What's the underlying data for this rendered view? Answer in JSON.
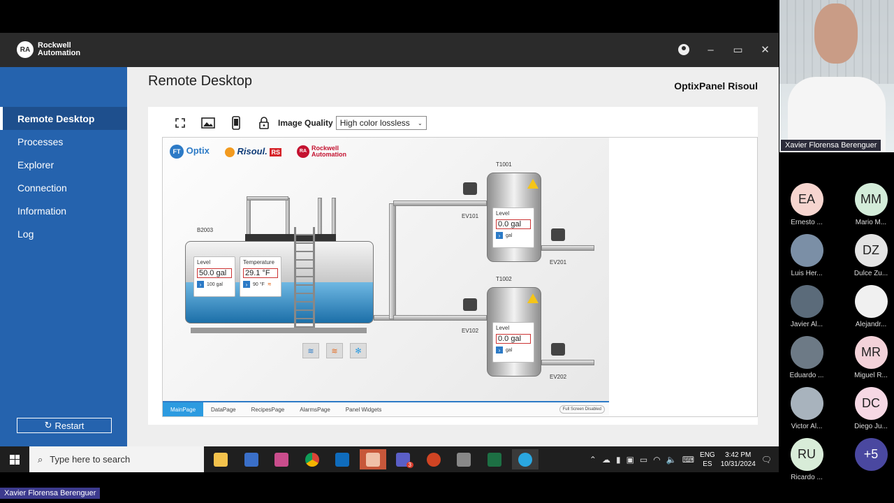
{
  "app": {
    "brand_line1": "Rockwell",
    "brand_line2": "Automation",
    "brand_badge": "RA",
    "page_title": "Remote Desktop",
    "panel_name": "OptixPanel Risoul",
    "nav": [
      "Remote Desktop",
      "Processes",
      "Explorer",
      "Connection",
      "Information",
      "Log"
    ],
    "restart_label": "Restart",
    "toolbar": {
      "quality_label": "Image Quality",
      "quality_value": "High color lossless"
    }
  },
  "hmi": {
    "logo_optix": "Optix",
    "logo_risoul": "Risoul.",
    "logo_rs": "RS",
    "logo_ra_line1": "Rockwell",
    "logo_ra_line2": "Automation",
    "tank_main": {
      "name": "B2003",
      "level_label": "Level",
      "level_value": "50.0 gal",
      "level_setpoint": "100 gal",
      "temp_label": "Temperature",
      "temp_value": "29.1 °F",
      "temp_setpoint": "90 °F"
    },
    "tank_t1001": {
      "name": "T1001",
      "level_label": "Level",
      "level_value": "0.0 gal",
      "unit": "gal"
    },
    "tank_t1002": {
      "name": "T1002",
      "level_label": "Level",
      "level_value": "0.0 gal",
      "unit": "gal"
    },
    "valves": [
      "EV101",
      "EV201",
      "EV102",
      "EV202"
    ],
    "tabs": [
      "MainPage",
      "DataPage",
      "RecipesPage",
      "AlarmsPage",
      "Panel Widgets"
    ],
    "fullscreen_status": "Full Screen Disabled"
  },
  "taskbar": {
    "search_placeholder": "Type here to search",
    "lang_line1": "ENG",
    "lang_line2": "ES",
    "time": "3:42 PM",
    "date": "10/31/2024",
    "teams_badge": "3"
  },
  "call": {
    "speaker_name": "Xavier Florensa Berenguer",
    "bottom_name": "Xavier Florensa Berenguer",
    "participants": [
      {
        "initials": "EA",
        "name": "Ernesto ...",
        "color": "#f6d5cf"
      },
      {
        "initials": "MM",
        "name": "Mario M...",
        "color": "#d3ecd9"
      },
      {
        "initials": "",
        "name": "Luis Her...",
        "color": "#7b8fa6"
      },
      {
        "initials": "DZ",
        "name": "Dulce Zu...",
        "color": "#e4e4e4"
      },
      {
        "initials": "",
        "name": "Javier Al...",
        "color": "#5b6b7a"
      },
      {
        "initials": "",
        "name": "Alejandr...",
        "color": "#f0f0f0"
      },
      {
        "initials": "",
        "name": "Eduardo ...",
        "color": "#6d7a86"
      },
      {
        "initials": "MR",
        "name": "Miguel R...",
        "color": "#f3d2d9"
      },
      {
        "initials": "",
        "name": "Victor Al...",
        "color": "#a8b3bd"
      },
      {
        "initials": "DC",
        "name": "Diego Ju...",
        "color": "#f6d8e4"
      },
      {
        "initials": "RU",
        "name": "Ricardo ...",
        "color": "#d8ecd8"
      },
      {
        "initials": "+5",
        "name": "",
        "color": "#4a48a0"
      }
    ]
  }
}
